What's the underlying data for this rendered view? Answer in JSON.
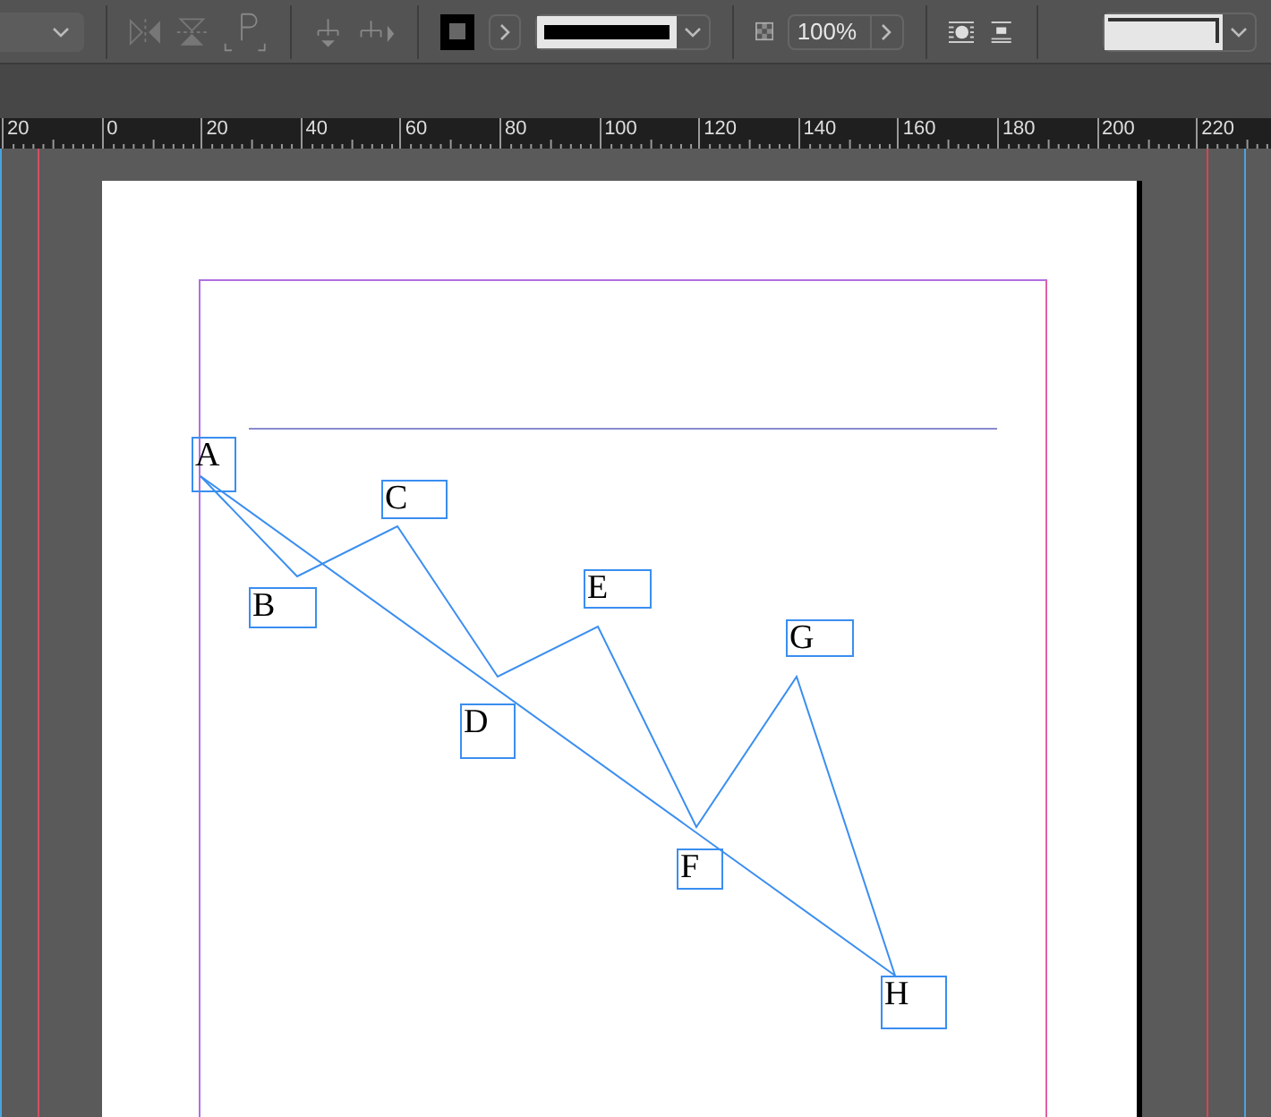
{
  "control_panel": {
    "opacity": {
      "value": "100%"
    }
  },
  "ruler": {
    "labels": [
      "20",
      "0",
      "20",
      "40",
      "60",
      "80",
      "100",
      "120",
      "140",
      "160",
      "180",
      "200",
      "220"
    ]
  },
  "diagram": {
    "frames": [
      {
        "label": "A"
      },
      {
        "label": "B"
      },
      {
        "label": "C"
      },
      {
        "label": "D"
      },
      {
        "label": "E"
      },
      {
        "label": "F"
      },
      {
        "label": "G"
      },
      {
        "label": "H"
      }
    ]
  }
}
